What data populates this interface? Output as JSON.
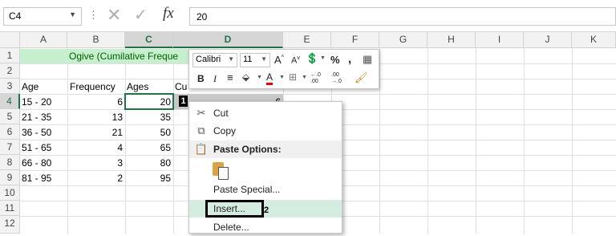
{
  "formula_bar": {
    "name_box": "C4",
    "fx_label": "fx",
    "value": "20"
  },
  "columns": [
    "A",
    "B",
    "C",
    "D",
    "E",
    "F",
    "G",
    "H",
    "I",
    "J",
    "K"
  ],
  "rows": [
    "1",
    "2",
    "3",
    "4",
    "5",
    "6",
    "7",
    "8",
    "9",
    "10",
    "11",
    "12"
  ],
  "sheet": {
    "title": "Ogive (Cumilative Freque",
    "headers": {
      "a": "Age",
      "b": "Frequency",
      "c": "Ages",
      "d": "Cu"
    },
    "data": [
      {
        "age": "15 - 20",
        "freq": "6",
        "ages": "20",
        "cum": "6"
      },
      {
        "age": "21 - 35",
        "freq": "13",
        "ages": "35"
      },
      {
        "age": "36 - 50",
        "freq": "21",
        "ages": "50"
      },
      {
        "age": "51 - 65",
        "freq": "4",
        "ages": "65"
      },
      {
        "age": "66 - 80",
        "freq": "3",
        "ages": "80"
      },
      {
        "age": "81 - 95",
        "freq": "2",
        "ages": "95"
      }
    ]
  },
  "mini_toolbar": {
    "font_name": "Calibri",
    "font_size": "11",
    "grow_font": "A",
    "shrink_font": "A",
    "percent": "%",
    "comma": ",",
    "bold": "B",
    "italic": "I",
    "font_color": "A",
    "inc_decimal": "←.0 .00",
    "dec_decimal": ".00 →.0"
  },
  "context_menu": {
    "cut": "Cut",
    "copy": "Copy",
    "paste_options": "Paste Options:",
    "paste_special": "Paste Special...",
    "insert": "Insert...",
    "delete": "Delete..."
  },
  "annotations": {
    "marker1": "1",
    "marker2": "2"
  },
  "colors": {
    "accent_green": "#217346",
    "title_fill": "#c6efce",
    "menu_highlight": "#d5ece1"
  }
}
